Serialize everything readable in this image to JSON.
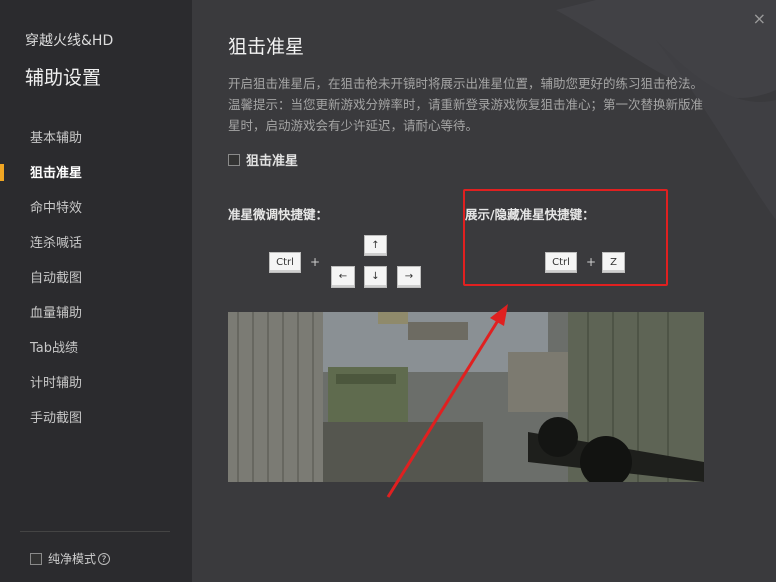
{
  "sidebar": {
    "app_title": "穿越火线&HD",
    "section_title": "辅助设置",
    "items": [
      {
        "label": "基本辅助"
      },
      {
        "label": "狙击准星"
      },
      {
        "label": "命中特效"
      },
      {
        "label": "连杀喊话"
      },
      {
        "label": "自动截图"
      },
      {
        "label": "血量辅助"
      },
      {
        "label": "Tab战绩"
      },
      {
        "label": "计时辅助"
      },
      {
        "label": "手动截图"
      }
    ],
    "active_index": 1,
    "pure_mode_label": "纯净模式",
    "help_symbol": "?"
  },
  "main": {
    "close_symbol": "×",
    "title": "狙击准星",
    "description": "开启狙击准星后，在狙击枪未开镜时将展示出准星位置，辅助您更好的练习狙击枪法。温馨提示：当您更新游戏分辨率时，请重新登录游戏恢复狙击准心；第一次替换新版准星时，启动游戏会有少许延迟，请耐心等待。",
    "toggle_label": "狙击准星",
    "toggle_checked": false,
    "fine_tune_label": "准星微调快捷键：",
    "show_hide_label": "展示/隐藏准星快捷键：",
    "keys": {
      "ctrl": "Ctrl",
      "plus": "+",
      "up": "↑",
      "left": "←",
      "down": "↓",
      "right": "→",
      "z": "Z"
    }
  },
  "colors": {
    "accent": "#f0a623",
    "highlight": "#e02020",
    "sidebar_bg": "#2b2b2e",
    "main_bg": "#3a3a3d"
  }
}
